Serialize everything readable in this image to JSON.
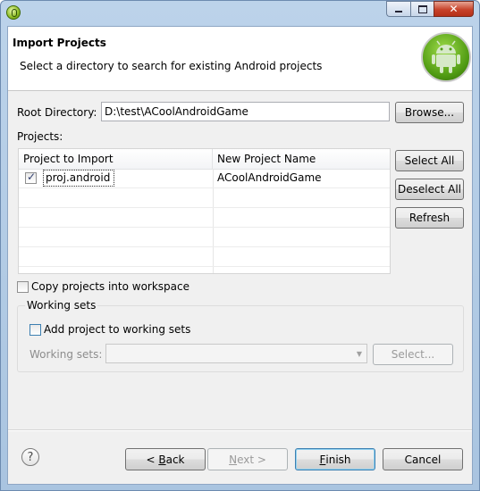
{
  "window": {
    "close_glyph": "✕"
  },
  "header": {
    "title": "Import Projects",
    "description": "Select a directory to search for existing Android projects"
  },
  "root_directory": {
    "label": "Root Directory:",
    "value": "D:\\test\\ACoolAndroidGame",
    "browse_label": "Browse..."
  },
  "projects": {
    "label": "Projects:",
    "columns": [
      "Project to Import",
      "New Project Name"
    ],
    "rows": [
      {
        "project": "proj.android",
        "new_name": "ACoolAndroidGame",
        "checked": true
      }
    ],
    "select_all_label": "Select All",
    "deselect_all_label": "Deselect All",
    "refresh_label": "Refresh"
  },
  "options": {
    "copy_label": "Copy projects into workspace"
  },
  "working_sets": {
    "legend": "Working sets",
    "add_label": "Add project to working sets",
    "field_label": "Working sets:",
    "select_label": "Select..."
  },
  "footer": {
    "help_glyph": "?",
    "back_prefix": "< ",
    "back_key": "B",
    "back_rest": "ack",
    "next_key": "N",
    "next_rest": "ext >",
    "finish_key": "F",
    "finish_rest": "inish",
    "cancel_label": "Cancel"
  },
  "colors": {
    "window_frame": "#a9c4e0",
    "close_button": "#c7432b",
    "android_green": "#4f9a12",
    "default_button_border": "#3c7fb1"
  }
}
